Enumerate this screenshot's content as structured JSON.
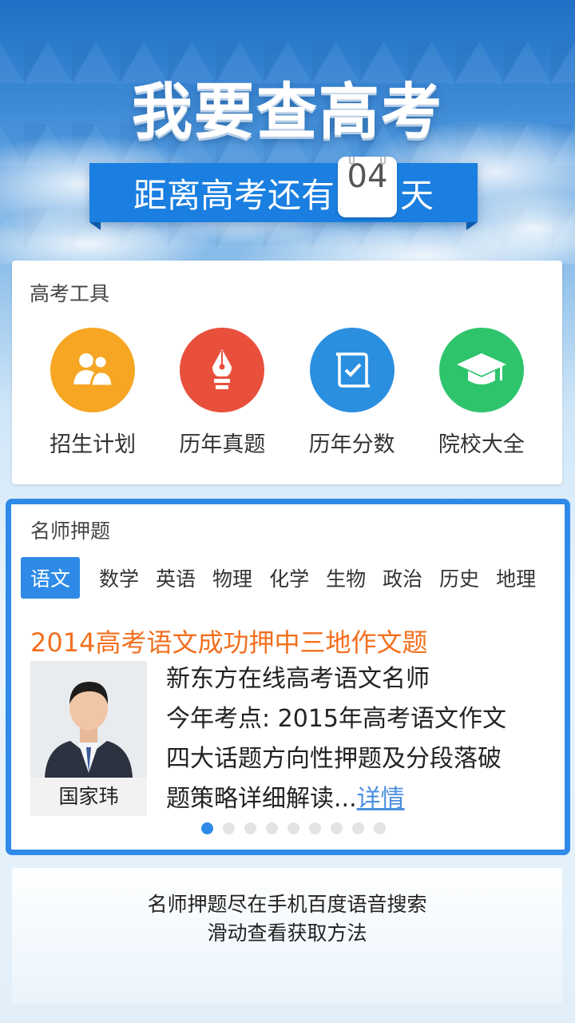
{
  "header": {
    "title": "我要查高考",
    "countdown_prefix": "距离高考还有",
    "countdown_days": "04",
    "countdown_suffix": "天"
  },
  "tools": {
    "title": "高考工具",
    "items": [
      {
        "label": "招生计划",
        "icon": "people-icon",
        "color": "#f6a623"
      },
      {
        "label": "历年真题",
        "icon": "pen-nib-icon",
        "color": "#e8503c"
      },
      {
        "label": "历年分数",
        "icon": "scroll-check-icon",
        "color": "#2b8fe0"
      },
      {
        "label": "院校大全",
        "icon": "graduation-cap-icon",
        "color": "#2ec46c"
      }
    ]
  },
  "exam": {
    "title": "名师押题",
    "subjects": [
      "语文",
      "数学",
      "英语",
      "物理",
      "化学",
      "生物",
      "政治",
      "历史",
      "地理"
    ],
    "active_subject": "语文",
    "headline": "2014高考语文成功押中三地作文题",
    "teacher_name": "国家玮",
    "description_lines": [
      "新东方在线高考语文名师",
      "今年考点: 2015年高考语文作文",
      "四大话题方向性押题及分段落破",
      "题策略详细解读..."
    ],
    "more_link": "详情",
    "page_count": 9,
    "current_page": 1
  },
  "footer": {
    "line1": "名师押题尽在手机百度语音搜索",
    "line2": "滑动查看获取方法"
  },
  "colors": {
    "accent": "#2e8ae6",
    "headline": "#f3701f"
  }
}
